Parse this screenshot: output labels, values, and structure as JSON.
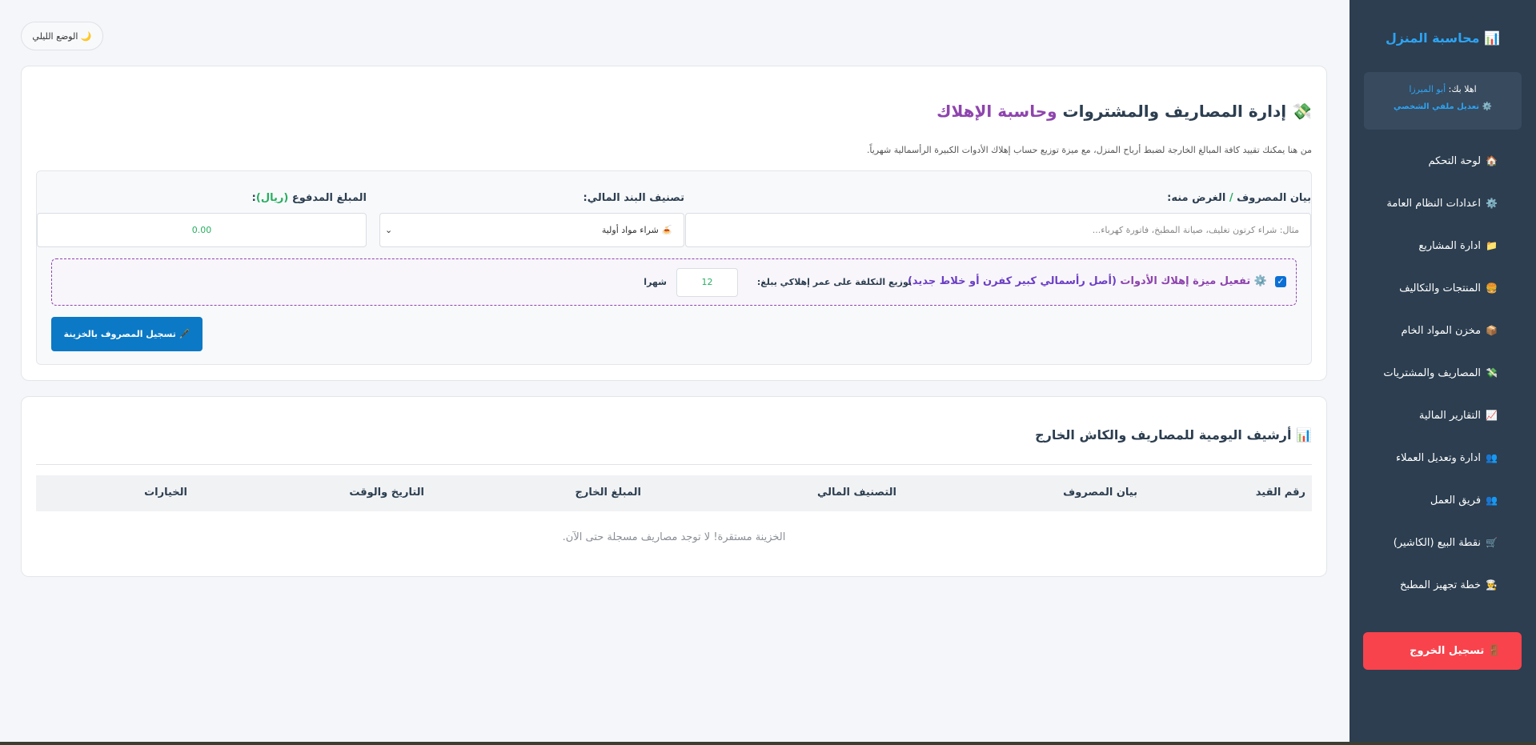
{
  "sidebar": {
    "brand": "📊 محاسبة المنزل",
    "greeting": "اهلا بك: ",
    "username": "أبو الميرزا",
    "edit_profile": "⚙️ تعديل ملفي الشخصي",
    "items": [
      {
        "icon": "🏠",
        "label": "لوحة التحكم"
      },
      {
        "icon": "⚙️",
        "label": "اعدادات النظام العامة"
      },
      {
        "icon": "📁",
        "label": "ادارة المشاريع"
      },
      {
        "icon": "🍔",
        "label": "المنتجات والتكاليف"
      },
      {
        "icon": "📦",
        "label": "مخزن المواد الخام"
      },
      {
        "icon": "💸",
        "label": "المصاريف والمشتريات"
      },
      {
        "icon": "📈",
        "label": "التقارير المالية"
      },
      {
        "icon": "👥",
        "label": "ادارة وتعديل العملاء"
      },
      {
        "icon": "👥",
        "label": "فريق العمل"
      },
      {
        "icon": "🛒",
        "label": "نقطة البيع (الكاشير)"
      },
      {
        "icon": "👨‍🍳",
        "label": "خطة تجهيز المطبخ"
      }
    ],
    "logout": "🚪 تسجيل الخروج"
  },
  "night_mode": "🌙 الوضع الليلي",
  "form_card": {
    "title_icon": "💸",
    "title_main": "إدارة المصاريف والمشتروات ",
    "title_accent": "وحاسبة الإهلاك",
    "subtitle": "من هنا يمكنك تقييد كافة المبالغ الخارجة لضبط أرباح المنزل، مع ميزة توزيع حساب إهلاك الأدوات الكبيرة الرأسمالية شهرياً.",
    "desc_label_a": "بيان المصروف ",
    "desc_label_sep": "/",
    "desc_label_b": " الغرض منه:",
    "desc_placeholder": "مثال: شراء كرتون تغليف، صيانة المطبخ، فاتورة كهرباء...",
    "cat_label": "تصنيف البند المالي:",
    "cat_selected": "🍝 شراء مواد أولية",
    "amount_label_a": "المبلغ المدفوع ",
    "amount_label_b": "(ريال)",
    "amount_label_c": ":",
    "amount_value": "0.00",
    "dep_checked": "✓",
    "dep_icon": "⚙️",
    "dep_text": " تفعيل ميزة إهلاك الأدوات ",
    "dep_strong": "(أصل رأسمالي كبير كفرن أو خلاط جديد)",
    "dep_distribute": "توزيع التكلفة على عمر إهلاكي يبلغ:",
    "dep_months_value": "12",
    "dep_months_unit": "شهرا",
    "submit": "🖋️ تسجيل المصروف بالخزينة"
  },
  "archive_card": {
    "title": "📊 أرشيف اليومية للمصاريف والكاش الخارج",
    "columns": [
      "رقم القيد",
      "بيان المصروف",
      "التصنيف المالي",
      "المبلغ الخارج",
      "التاريخ والوقت",
      "الخيارات"
    ],
    "empty_message": "الخزينة مستقرة! لا توجد مصاريف مسجلة حتى الآن."
  }
}
